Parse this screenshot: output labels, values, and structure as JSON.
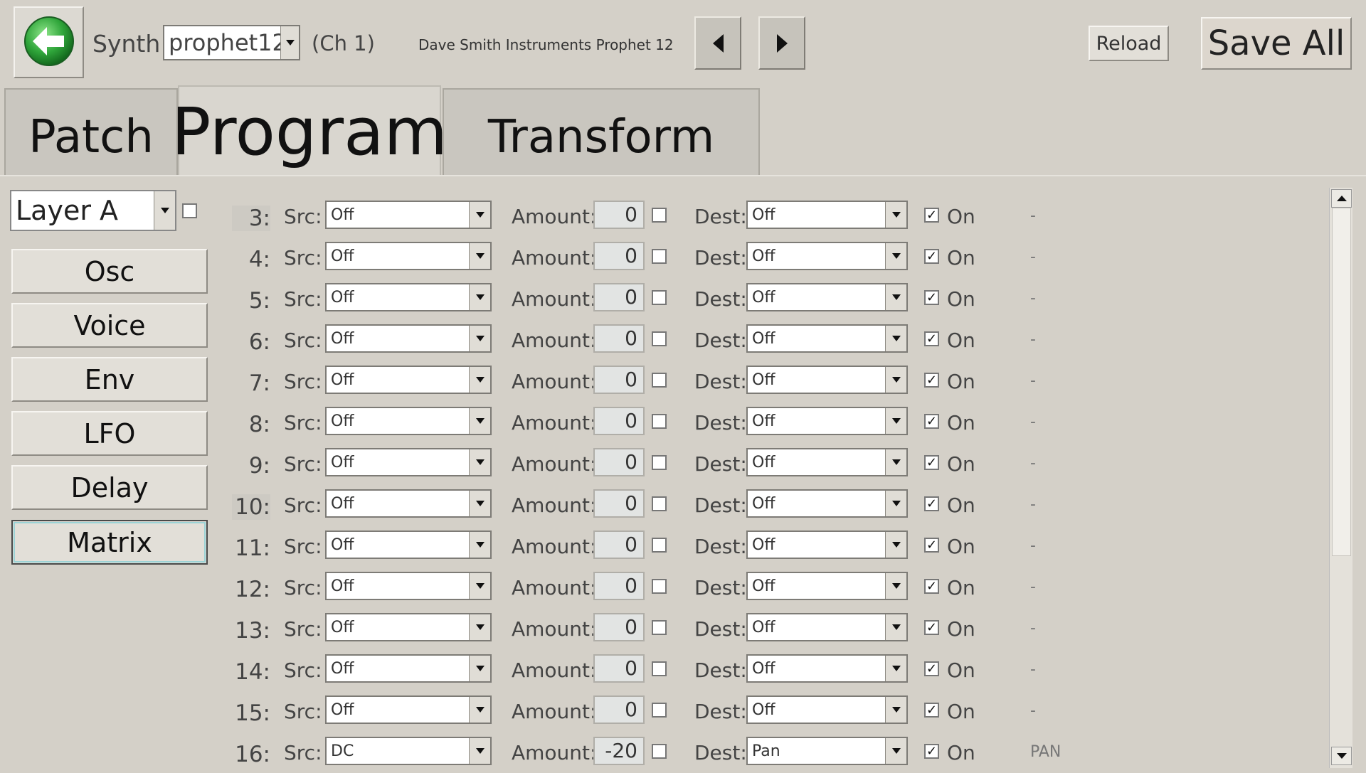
{
  "header": {
    "synth_label": "Synth:",
    "synth_value": "prophet12",
    "channel": "(Ch 1)",
    "synth_name": "Dave Smith Instruments Prophet 12",
    "reload_label": "Reload",
    "save_all_label": "Save All",
    "back_icon": "back-arrow-icon",
    "back_icon_color": "#2fa53a"
  },
  "tabs": [
    {
      "label": "Patch"
    },
    {
      "label": "Program",
      "selected": true
    },
    {
      "label": "Transform"
    }
  ],
  "sidebar": {
    "layer_value": "Layer A",
    "layer_checked": false,
    "sections": [
      {
        "label": "Osc"
      },
      {
        "label": "Voice"
      },
      {
        "label": "Env"
      },
      {
        "label": "LFO"
      },
      {
        "label": "Delay"
      },
      {
        "label": "Matrix",
        "selected": true
      }
    ]
  },
  "matrix": {
    "src_label": "Src:",
    "amount_label": "Amount:",
    "dest_label": "Dest:",
    "on_label": "On",
    "rows": [
      {
        "num": "3:",
        "src": "Off",
        "amount": "0",
        "amount_checked": false,
        "dest": "Off",
        "on": true,
        "extra": "-"
      },
      {
        "num": "4:",
        "src": "Off",
        "amount": "0",
        "amount_checked": false,
        "dest": "Off",
        "on": true,
        "extra": "-"
      },
      {
        "num": "5:",
        "src": "Off",
        "amount": "0",
        "amount_checked": false,
        "dest": "Off",
        "on": true,
        "extra": "-"
      },
      {
        "num": "6:",
        "src": "Off",
        "amount": "0",
        "amount_checked": false,
        "dest": "Off",
        "on": true,
        "extra": "-"
      },
      {
        "num": "7:",
        "src": "Off",
        "amount": "0",
        "amount_checked": false,
        "dest": "Off",
        "on": true,
        "extra": "-"
      },
      {
        "num": "8:",
        "src": "Off",
        "amount": "0",
        "amount_checked": false,
        "dest": "Off",
        "on": true,
        "extra": "-"
      },
      {
        "num": "9:",
        "src": "Off",
        "amount": "0",
        "amount_checked": false,
        "dest": "Off",
        "on": true,
        "extra": "-"
      },
      {
        "num": "10:",
        "src": "Off",
        "amount": "0",
        "amount_checked": false,
        "dest": "Off",
        "on": true,
        "extra": "-"
      },
      {
        "num": "11:",
        "src": "Off",
        "amount": "0",
        "amount_checked": false,
        "dest": "Off",
        "on": true,
        "extra": "-"
      },
      {
        "num": "12:",
        "src": "Off",
        "amount": "0",
        "amount_checked": false,
        "dest": "Off",
        "on": true,
        "extra": "-"
      },
      {
        "num": "13:",
        "src": "Off",
        "amount": "0",
        "amount_checked": false,
        "dest": "Off",
        "on": true,
        "extra": "-"
      },
      {
        "num": "14:",
        "src": "Off",
        "amount": "0",
        "amount_checked": false,
        "dest": "Off",
        "on": true,
        "extra": "-"
      },
      {
        "num": "15:",
        "src": "Off",
        "amount": "0",
        "amount_checked": false,
        "dest": "Off",
        "on": true,
        "extra": "-"
      },
      {
        "num": "16:",
        "src": "DC",
        "amount": "-20",
        "amount_checked": false,
        "dest": "Pan",
        "on": true,
        "extra": "PAN"
      }
    ]
  }
}
